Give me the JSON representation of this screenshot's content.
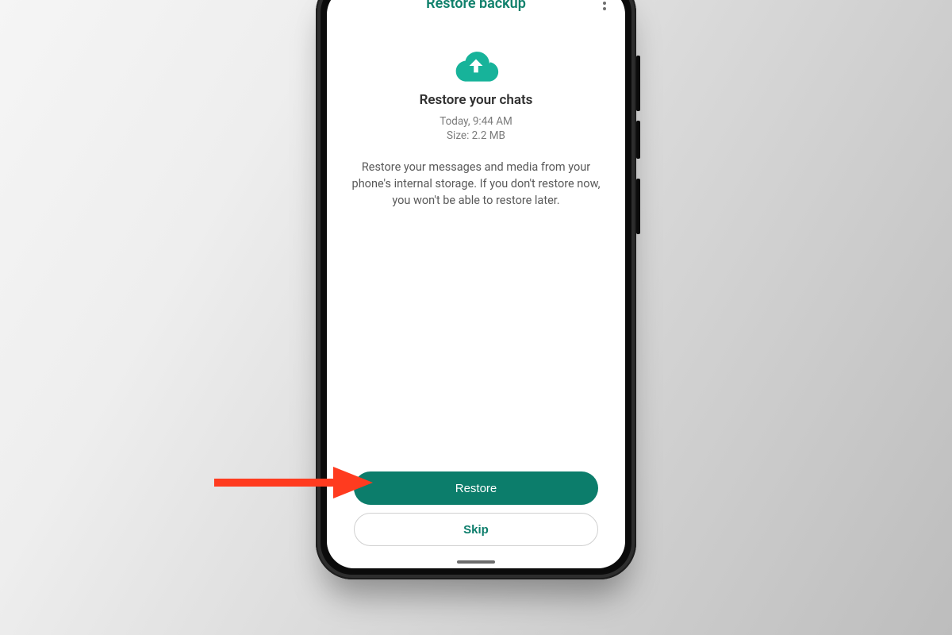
{
  "colors": {
    "accent": "#0c7d6b",
    "arrow": "#ff3b1f"
  },
  "header": {
    "title": "Restore backup"
  },
  "body": {
    "subtitle": "Restore your chats",
    "timestamp": "Today, 9:44 AM",
    "size_line": "Size: 2.2 MB",
    "description": "Restore your messages and media from your phone's internal storage. If you don't restore now, you won't be able to restore later."
  },
  "buttons": {
    "primary": "Restore",
    "secondary": "Skip"
  }
}
